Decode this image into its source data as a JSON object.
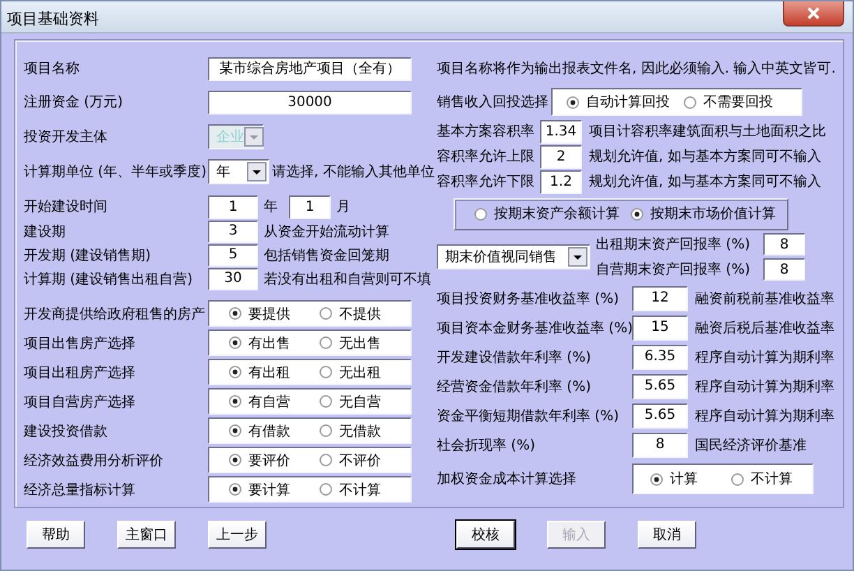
{
  "window": {
    "title": "项目基础资料"
  },
  "left": {
    "project_name": {
      "label": "项目名称",
      "value": "某市综合房地产项目（全有）"
    },
    "capital": {
      "label": "注册资金 (万元)",
      "value": "30000"
    },
    "investor": {
      "label": "投资开发主体",
      "value": "企业",
      "disabled": true
    },
    "period_unit": {
      "label": "计算期单位 (年、半年或季度)",
      "value": "年",
      "disabled": false,
      "note": "请选择, 不能输入其他单位"
    },
    "start": {
      "label": "开始建设时间",
      "year": "1",
      "year_unit": "年",
      "month": "1",
      "month_unit": "月"
    },
    "periods": [
      {
        "label": "建设期",
        "value": "3",
        "note": "从资金开始流动计算"
      },
      {
        "label": "开发期 (建设销售期)",
        "value": "5",
        "note": "包括销售资金回笼期"
      },
      {
        "label": "计算期 (建设销售出租自营)",
        "value": "30",
        "note": "若没有出租和自营则可不填"
      }
    ],
    "choices": [
      {
        "label": "开发商提供给政府租售的房产",
        "options": [
          {
            "label": "要提供",
            "selected": true
          },
          {
            "label": "不提供",
            "selected": false
          }
        ]
      },
      {
        "label": "项目出售房产选择",
        "options": [
          {
            "label": "有出售",
            "selected": true
          },
          {
            "label": "无出售",
            "selected": false
          }
        ]
      },
      {
        "label": "项目出租房产选择",
        "options": [
          {
            "label": "有出租",
            "selected": true
          },
          {
            "label": "无出租",
            "selected": false
          }
        ]
      },
      {
        "label": "项目自营房产选择",
        "options": [
          {
            "label": "有自营",
            "selected": true
          },
          {
            "label": "无自营",
            "selected": false
          }
        ]
      },
      {
        "label": "建设投资借款",
        "options": [
          {
            "label": "有借款",
            "selected": true
          },
          {
            "label": "无借款",
            "selected": false
          }
        ]
      },
      {
        "label": "经济效益费用分析评价",
        "options": [
          {
            "label": "要评价",
            "selected": true
          },
          {
            "label": "不评价",
            "selected": false
          }
        ]
      },
      {
        "label": "经济总量指标计算",
        "options": [
          {
            "label": "要计算",
            "selected": true
          },
          {
            "label": "不计算",
            "selected": false
          }
        ]
      }
    ]
  },
  "right": {
    "note": "项目名称将作为输出报表文件名, 因此必须输入. 输入中英文皆可.",
    "sales_reinvest": {
      "label": "销售收入回投选择",
      "options": [
        {
          "label": "自动计算回投",
          "selected": true
        },
        {
          "label": "不需要回投",
          "selected": false
        }
      ]
    },
    "plot_ratios": [
      {
        "label": "基本方案容积率",
        "value": "1.34",
        "note": "项目计容积率建筑面积与土地面积之比"
      },
      {
        "label": "容积率允许上限",
        "value": "2",
        "note": "规划允许值, 如与基本方案同可不输入"
      },
      {
        "label": "容积率允许下限",
        "value": "1.2",
        "note": "规划允许值, 如与基本方案同可不输入"
      }
    ],
    "valuation": {
      "options": [
        {
          "label": "按期末资产余额计算",
          "selected": false
        },
        {
          "label": "按期末市场价值计算",
          "selected": true
        }
      ]
    },
    "terminal": {
      "method": "期末价值视同销售",
      "returns": [
        {
          "label": "出租期末资产回报率 (%)",
          "value": "8"
        },
        {
          "label": "自营期末资产回报率 (%)",
          "value": "8"
        }
      ]
    },
    "rates": [
      {
        "label": "项目投资财务基准收益率 (%)",
        "value": "12",
        "note": "融资前税前基准收益率"
      },
      {
        "label": "项目资本金财务基准收益率 (%)",
        "value": "15",
        "note": "融资后税后基准收益率"
      },
      {
        "label": "开发建设借款年利率 (%)",
        "value": "6.35",
        "note": "程序自动计算为期利率"
      },
      {
        "label": "经营资金借款年利率 (%)",
        "value": "5.65",
        "note": "程序自动计算为期利率"
      },
      {
        "label": "资金平衡短期借款年利率 (%)",
        "value": "5.65",
        "note": "程序自动计算为期利率"
      },
      {
        "label": "社会折现率 (%)",
        "value": "8",
        "note": "国民经济评价基准"
      }
    ],
    "wacc": {
      "label": "加权资金成本计算选择",
      "options": [
        {
          "label": "计算",
          "selected": true
        },
        {
          "label": "不计算",
          "selected": false
        }
      ]
    }
  },
  "nav_buttons": [
    {
      "label": "帮助",
      "disabled": false,
      "default": false
    },
    {
      "label": "主窗口",
      "disabled": false,
      "default": false
    },
    {
      "label": "上一步",
      "disabled": false,
      "default": false
    }
  ],
  "action_buttons": [
    {
      "label": "校核",
      "disabled": false,
      "default": true
    },
    {
      "label": "输入",
      "disabled": true,
      "default": false
    },
    {
      "label": "取消",
      "disabled": false,
      "default": false
    }
  ]
}
